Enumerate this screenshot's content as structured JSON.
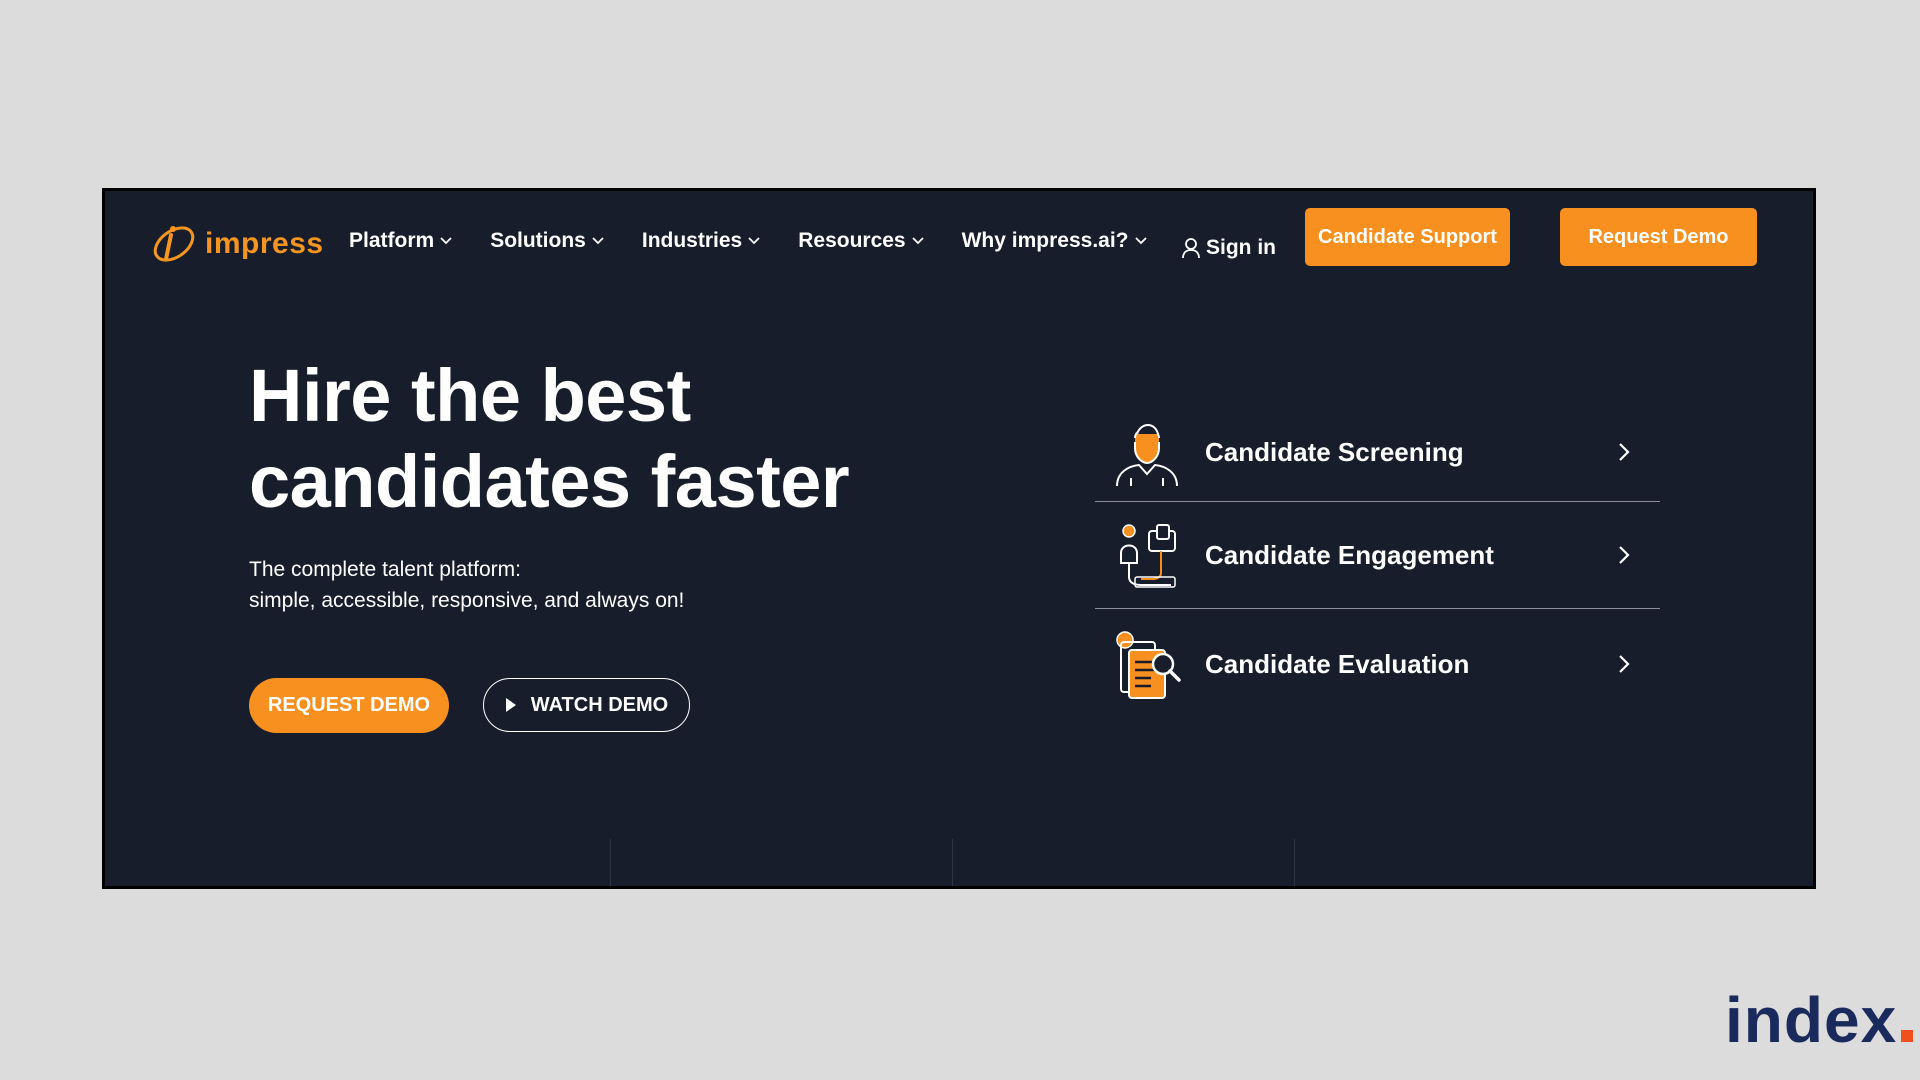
{
  "header": {
    "logo_text": "impress",
    "nav": [
      {
        "label": "Platform",
        "icon": "chevron-down-icon"
      },
      {
        "label": "Solutions",
        "icon": "chevron-down-icon"
      },
      {
        "label": "Industries",
        "icon": "chevron-down-icon"
      },
      {
        "label": "Resources",
        "icon": "chevron-down-icon"
      },
      {
        "label": "Why impress.ai?",
        "icon": "chevron-down-icon"
      }
    ],
    "sign_in": "Sign in",
    "candidate_support": "Candidate Support",
    "request_demo": "Request Demo"
  },
  "hero": {
    "title_line1": "Hire the best",
    "title_line2": "candidates faster",
    "subtitle_line1": "The complete talent platform:",
    "subtitle_line2": "simple, accessible, responsive, and always on!",
    "primary_cta": "REQUEST DEMO",
    "secondary_cta": "WATCH DEMO"
  },
  "features": [
    {
      "label": "Candidate Screening",
      "icon": "screening-person-icon"
    },
    {
      "label": "Candidate Engagement",
      "icon": "engagement-chat-icon"
    },
    {
      "label": "Candidate Evaluation",
      "icon": "evaluation-document-icon"
    }
  ],
  "watermark": {
    "text": "index"
  },
  "colors": {
    "accent": "#f7901e",
    "background": "#181d2c",
    "page_background": "#dcdcdc",
    "watermark_text": "#1b2a5c",
    "watermark_dot": "#f0501e"
  }
}
